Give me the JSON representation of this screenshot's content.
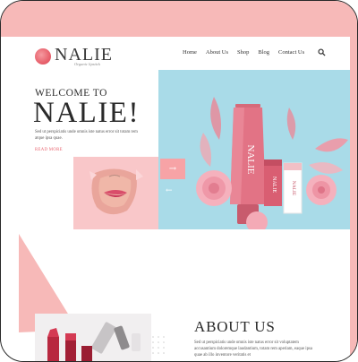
{
  "logo": {
    "name": "NALIE",
    "tagline": "Organic lipstick"
  },
  "nav": {
    "items": [
      "Home",
      "About Us",
      "Shop",
      "Blog",
      "Contact Us"
    ]
  },
  "hero": {
    "welcome": "WELCOME TO",
    "brand": "NALIE!",
    "description": "Sed ut perspiciatis unde omnis iste natus error sit totam rem atque ipsa quae.",
    "read_more": "READ MORE"
  },
  "product": {
    "name": "NALIE",
    "sub": "Organic lipstick"
  },
  "slider": {
    "next_icon": "arrow-right-icon",
    "prev_icon": "arrow-left-icon"
  },
  "about": {
    "title": "ABOUT US",
    "text": "Sed ut perspiciatis unde omnis iste natus error sit voluptatem accusantium doloremque laudantium, totam rem aperiam, eaque ipsa quae ab illo inventore veritatis et"
  },
  "colors": {
    "accent": "#e8626d",
    "pink": "#f7b9b8",
    "sky": "#a9dbe8"
  }
}
